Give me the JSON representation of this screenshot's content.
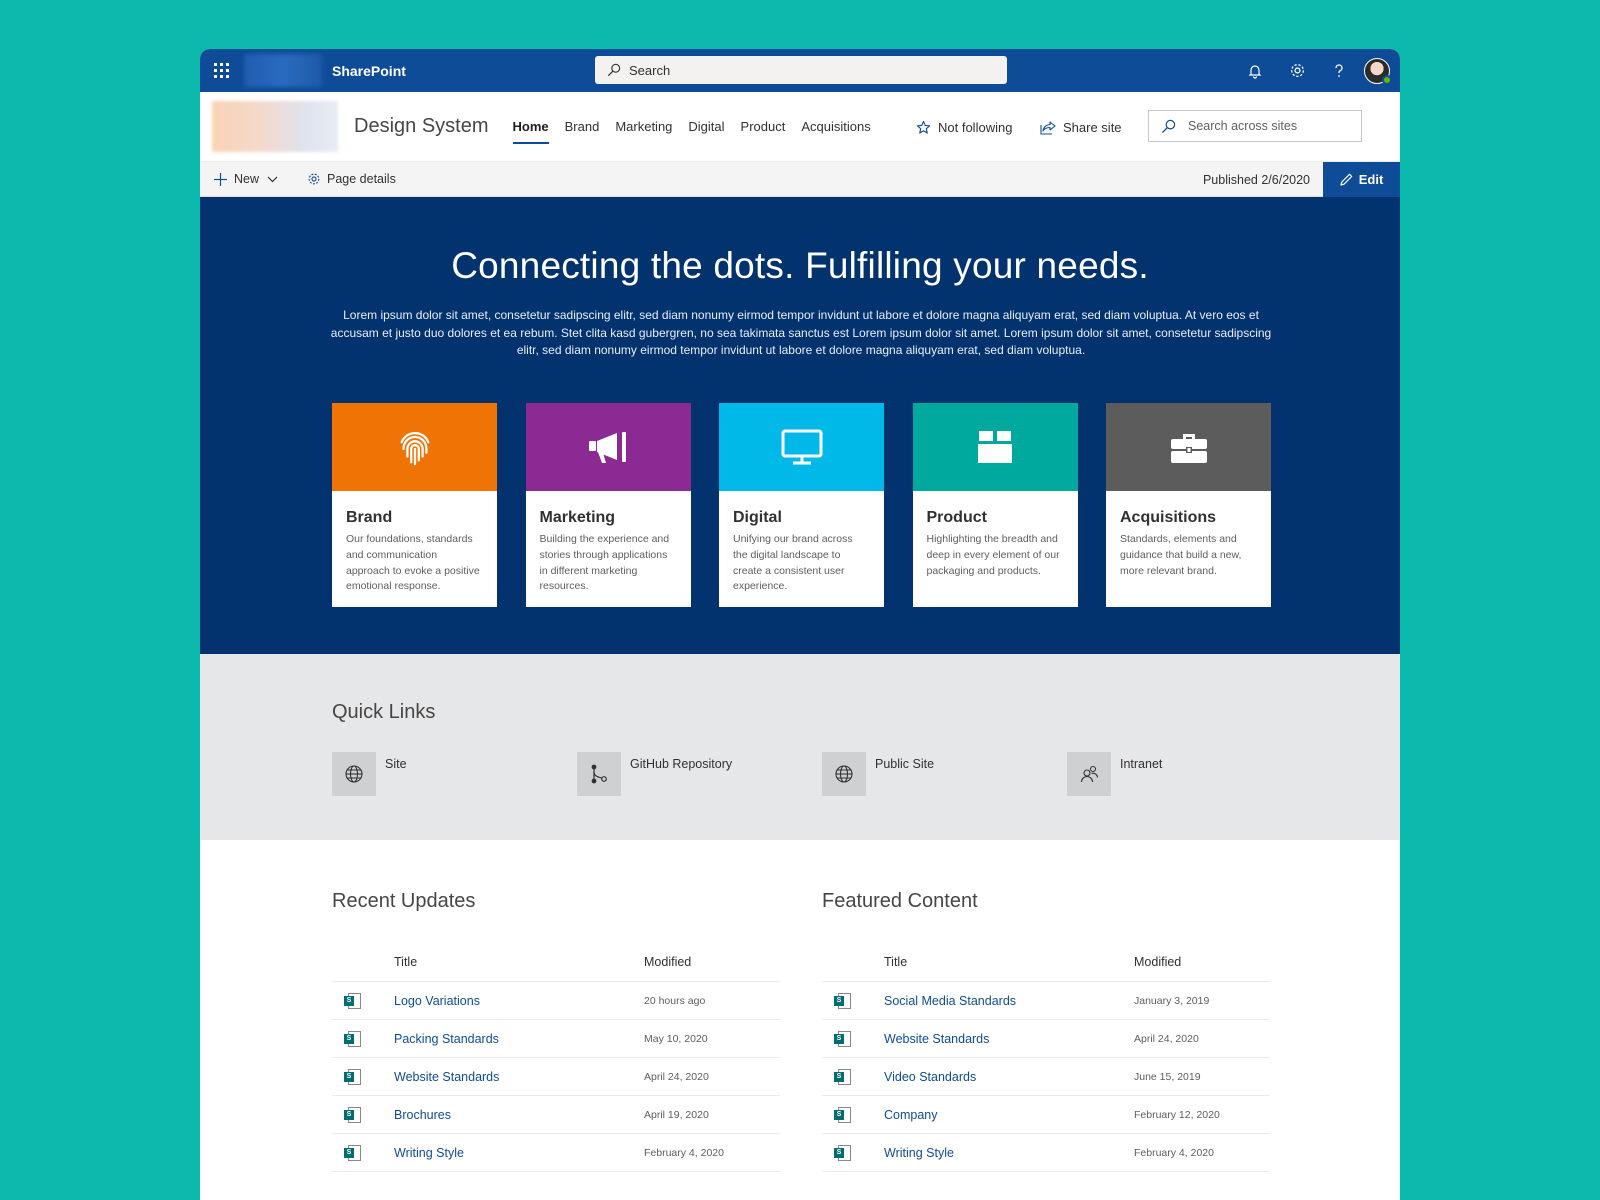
{
  "suite": {
    "app_name": "SharePoint",
    "search_placeholder": "Search"
  },
  "site": {
    "title": "Design System",
    "nav": [
      "Home",
      "Brand",
      "Marketing",
      "Digital",
      "Product",
      "Acquisitions"
    ],
    "follow_label": "Not following",
    "share_label": "Share site",
    "search_placeholder": "Search across sites"
  },
  "command_bar": {
    "new_label": "New",
    "page_details_label": "Page details",
    "published": "Published 2/6/2020",
    "edit_label": "Edit"
  },
  "hero": {
    "title": "Connecting the dots. Fulfilling your needs.",
    "description": "Lorem ipsum dolor sit amet, consetetur sadipscing elitr, sed diam nonumy eirmod tempor invidunt ut labore et dolore magna aliquyam erat, sed diam voluptua. At vero eos et accusam et justo duo dolores et ea rebum. Stet clita kasd gubergren, no sea takimata sanctus est Lorem ipsum dolor sit amet. Lorem ipsum dolor sit amet, consetetur sadipscing elitr, sed diam nonumy eirmod tempor invidunt ut labore et dolore magna aliquyam erat, sed diam voluptua.",
    "cards": [
      {
        "title": "Brand",
        "text": "Our foundations, standards and communication approach to evoke a positive emotional response.",
        "color": "#f07305",
        "icon": "fingerprint-icon"
      },
      {
        "title": "Marketing",
        "text": "Building the experience and stories through applications in different marketing resources.",
        "color": "#8b2a92",
        "icon": "megaphone-icon"
      },
      {
        "title": "Digital",
        "text": "Unifying our brand across the digital landscape to create a consistent user experience.",
        "color": "#00b9e8",
        "icon": "monitor-icon"
      },
      {
        "title": "Product",
        "text": "Highlighting the breadth and deep in every element of our packaging and products.",
        "color": "#00a99e",
        "icon": "box-icon"
      },
      {
        "title": "Acquisitions",
        "text": "Standards, elements and guidance that build a new, more relevant brand.",
        "color": "#5c5c5c",
        "icon": "briefcase-icon"
      }
    ]
  },
  "quick_links": {
    "title": "Quick Links",
    "items": [
      {
        "label": "Site",
        "icon": "globe-icon"
      },
      {
        "label": "GitHub Repository",
        "icon": "branch-icon"
      },
      {
        "label": "Public Site",
        "icon": "globe-icon"
      },
      {
        "label": "Intranet",
        "icon": "people-icon"
      }
    ]
  },
  "recent_updates": {
    "title": "Recent Updates",
    "columns": [
      "Title",
      "Modified"
    ],
    "rows": [
      {
        "title": "Logo Variations",
        "modified": "20 hours ago"
      },
      {
        "title": "Packing Standards",
        "modified": "May 10, 2020"
      },
      {
        "title": "Website Standards",
        "modified": "April 24, 2020"
      },
      {
        "title": "Brochures",
        "modified": "April 19, 2020"
      },
      {
        "title": "Writing Style",
        "modified": "February 4, 2020"
      }
    ]
  },
  "featured_content": {
    "title": "Featured Content",
    "columns": [
      "Title",
      "Modified"
    ],
    "rows": [
      {
        "title": "Social Media Standards",
        "modified": "January 3, 2019"
      },
      {
        "title": "Website Standards",
        "modified": "April 24, 2020"
      },
      {
        "title": "Video Standards",
        "modified": "June 15, 2019"
      },
      {
        "title": "Company",
        "modified": "February 12, 2020"
      },
      {
        "title": "Writing Style",
        "modified": "February 4, 2020"
      }
    ]
  },
  "colors": {
    "suite_bar": "#0f4c97",
    "hero_bg": "#03336e",
    "accent": "#0f4c97",
    "page_bg": "#0bb9ad"
  }
}
